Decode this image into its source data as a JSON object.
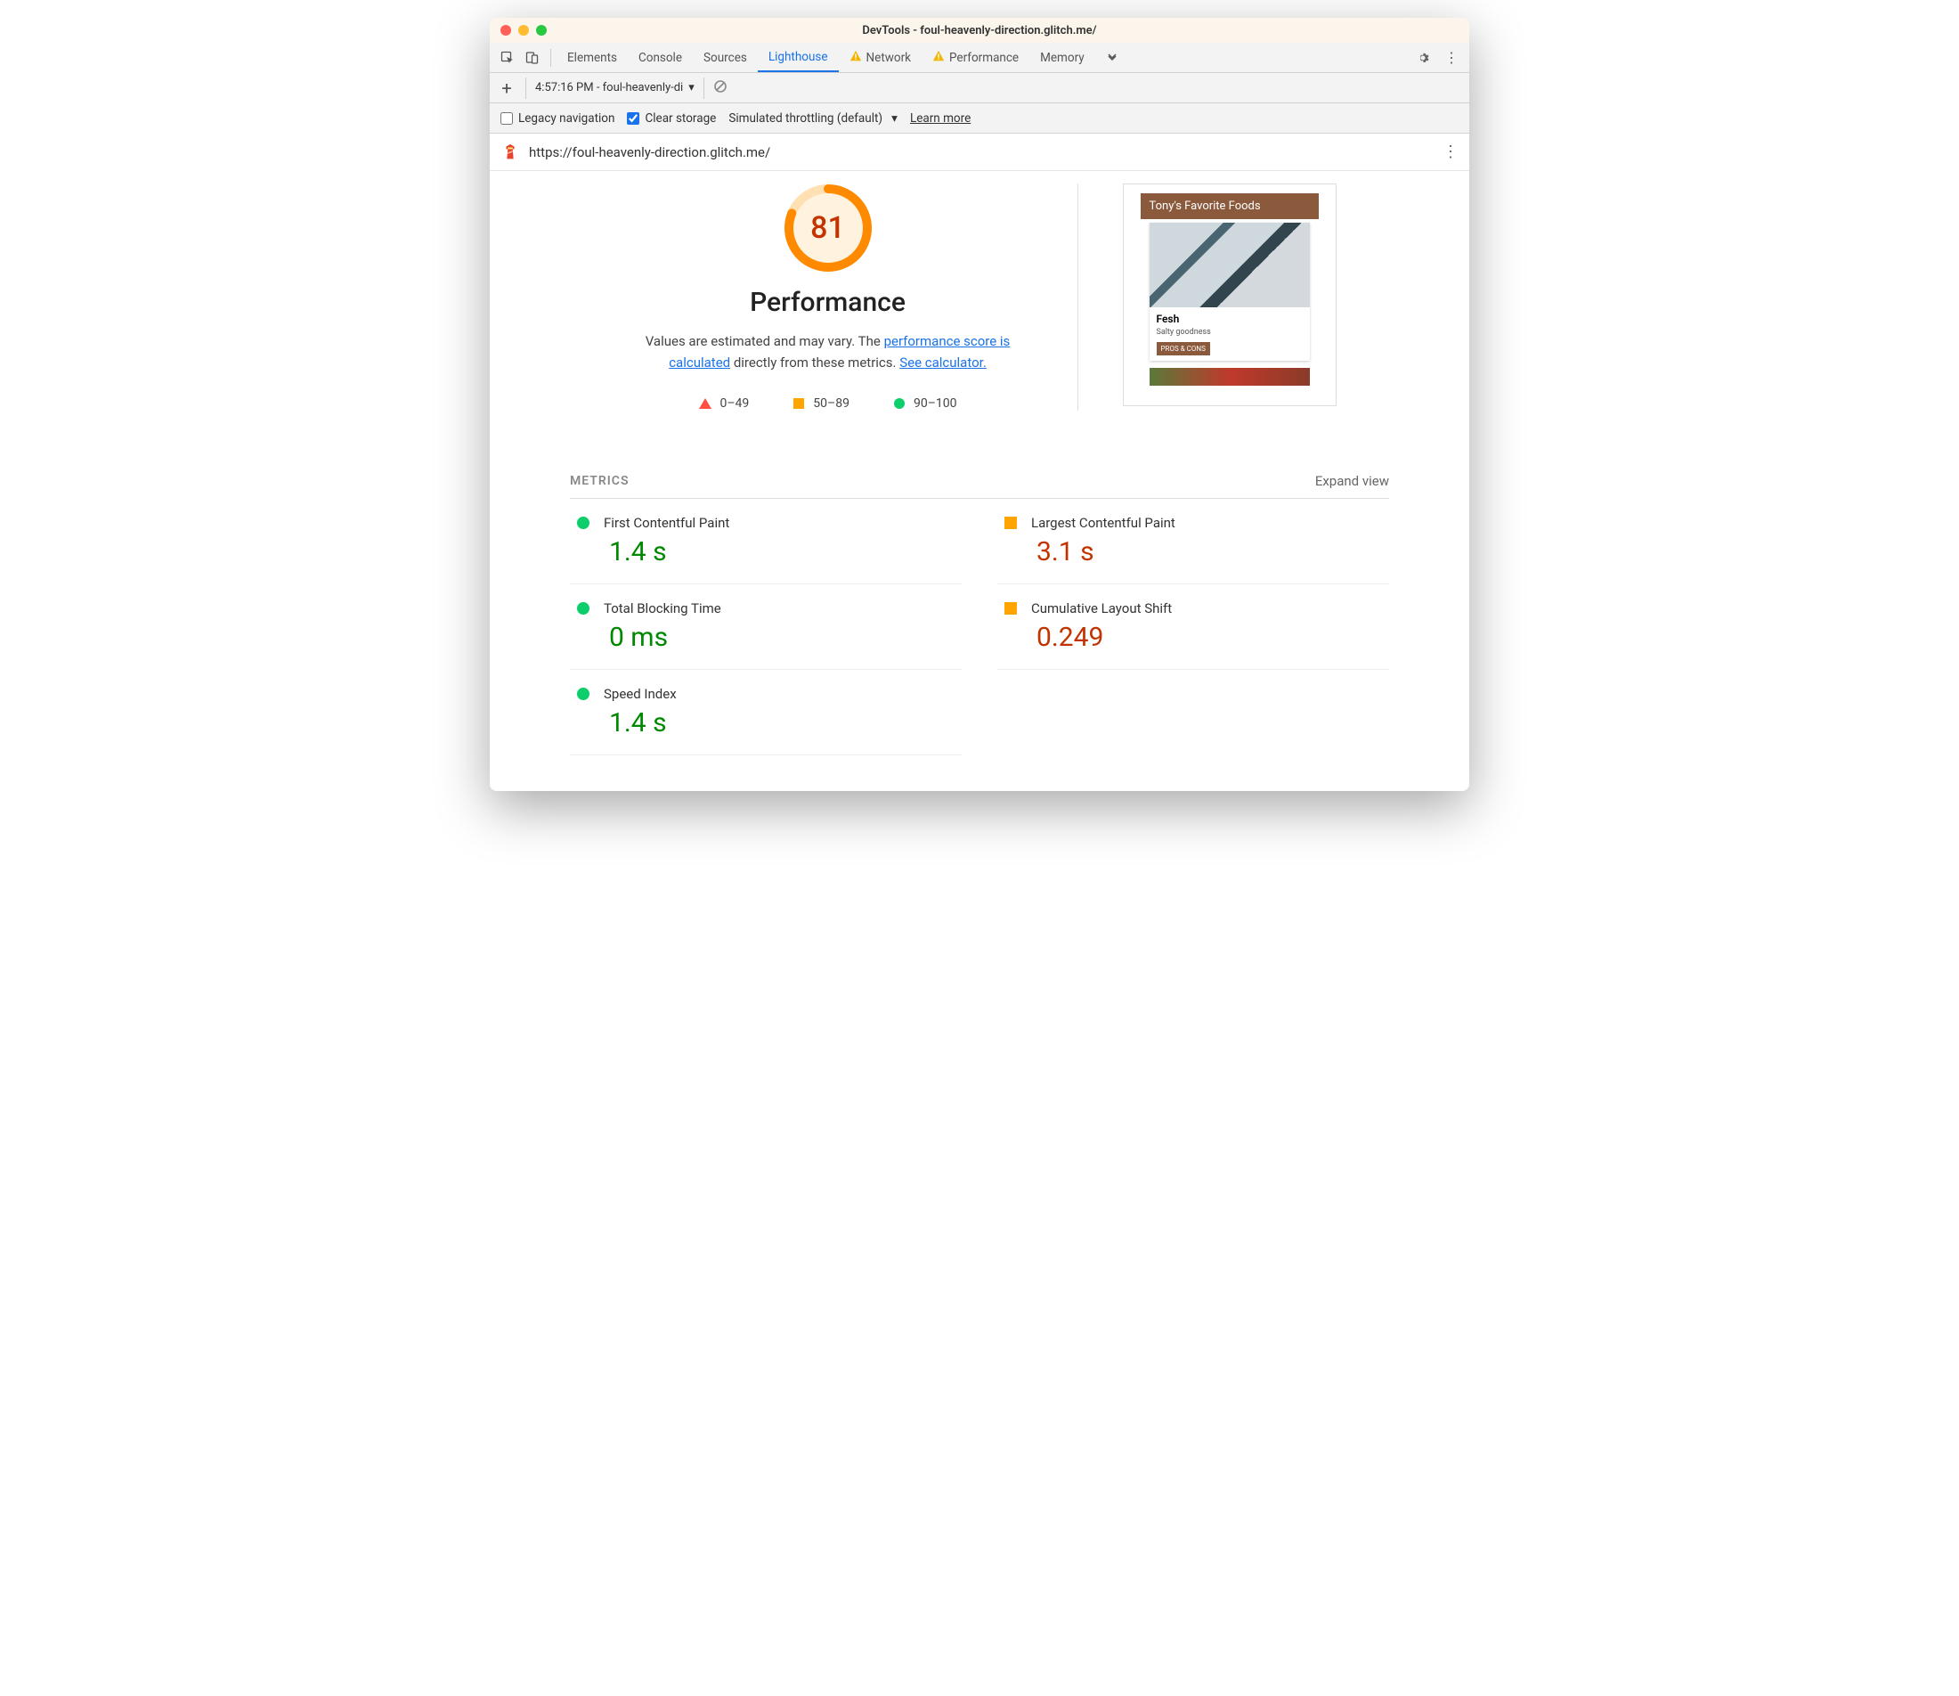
{
  "window": {
    "title": "DevTools - foul-heavenly-direction.glitch.me/"
  },
  "tabs": {
    "items": [
      "Elements",
      "Console",
      "Sources",
      "Lighthouse",
      "Network",
      "Performance",
      "Memory"
    ],
    "active": "Lighthouse",
    "warn": [
      "Network",
      "Performance"
    ]
  },
  "secbar": {
    "run_label": "4:57:16 PM - foul-heavenly-di"
  },
  "options": {
    "legacy_label": "Legacy navigation",
    "legacy_checked": false,
    "clear_label": "Clear storage",
    "clear_checked": true,
    "throttle_label": "Simulated throttling (default)",
    "learn_more": "Learn more"
  },
  "urlbar": {
    "url": "https://foul-heavenly-direction.glitch.me/"
  },
  "gauge": {
    "score": "81",
    "title": "Performance",
    "desc_prefix": "Values are estimated and may vary. The ",
    "link1": "performance score is calculated",
    "desc_mid": " directly from these metrics. ",
    "link2": "See calculator."
  },
  "legend": {
    "red": "0–49",
    "orange": "50–89",
    "green": "90–100"
  },
  "preview": {
    "header": "Tony's Favorite Foods",
    "card_name": "Fesh",
    "card_sub": "Salty goodness",
    "card_btn": "PROS & CONS"
  },
  "metrics": {
    "title": "METRICS",
    "expand": "Expand view",
    "items": [
      {
        "name": "First Contentful Paint",
        "value": "1.4 s",
        "status": "green"
      },
      {
        "name": "Largest Contentful Paint",
        "value": "3.1 s",
        "status": "orange"
      },
      {
        "name": "Total Blocking Time",
        "value": "0 ms",
        "status": "green"
      },
      {
        "name": "Cumulative Layout Shift",
        "value": "0.249",
        "status": "orange"
      },
      {
        "name": "Speed Index",
        "value": "1.4 s",
        "status": "green"
      }
    ]
  },
  "chart_data": {
    "type": "table",
    "title": "Lighthouse Performance Metrics",
    "overall_score": 81,
    "score_ranges": {
      "fail": "0–49",
      "average": "50–89",
      "pass": "90–100"
    },
    "metrics": [
      {
        "metric": "First Contentful Paint",
        "value": 1.4,
        "unit": "s",
        "rating": "good"
      },
      {
        "metric": "Largest Contentful Paint",
        "value": 3.1,
        "unit": "s",
        "rating": "average"
      },
      {
        "metric": "Total Blocking Time",
        "value": 0,
        "unit": "ms",
        "rating": "good"
      },
      {
        "metric": "Cumulative Layout Shift",
        "value": 0.249,
        "unit": "",
        "rating": "average"
      },
      {
        "metric": "Speed Index",
        "value": 1.4,
        "unit": "s",
        "rating": "good"
      }
    ]
  }
}
